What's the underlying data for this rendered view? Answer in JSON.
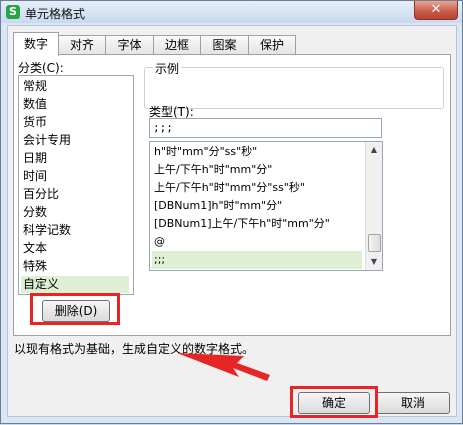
{
  "window": {
    "title": "单元格格式",
    "app_icon_letter": "S",
    "close_glyph": "✕"
  },
  "tabs": [
    {
      "label": "数字",
      "active": true
    },
    {
      "label": "对齐"
    },
    {
      "label": "字体"
    },
    {
      "label": "边框"
    },
    {
      "label": "图案"
    },
    {
      "label": "保护"
    }
  ],
  "category": {
    "label": "分类(C):",
    "items": [
      "常规",
      "数值",
      "货币",
      "会计专用",
      "日期",
      "时间",
      "百分比",
      "分数",
      "科学记数",
      "文本",
      "特殊",
      "自定义"
    ],
    "selected": "自定义"
  },
  "sample": {
    "label": "示例"
  },
  "type": {
    "label": "类型(T):",
    "value": ";;;",
    "items": [
      "h\"时\"mm\"分\"ss\"秒\"",
      "上午/下午h\"时\"mm\"分\"",
      "上午/下午h\"时\"mm\"分\"ss\"秒\"",
      "[DBNum1]h\"时\"mm\"分\"",
      "[DBNum1]上午/下午h\"时\"mm\"分\"",
      "@",
      ";;;"
    ],
    "selected": ";;;"
  },
  "delete_button": {
    "label": "删除(D)"
  },
  "description": "以现有格式为基础，生成自定义的数字格式。",
  "ok_button": {
    "label": "确定"
  },
  "cancel_button": {
    "label": "取消"
  },
  "annotation_color": "#e62525",
  "selection_color": "#dfefd4"
}
